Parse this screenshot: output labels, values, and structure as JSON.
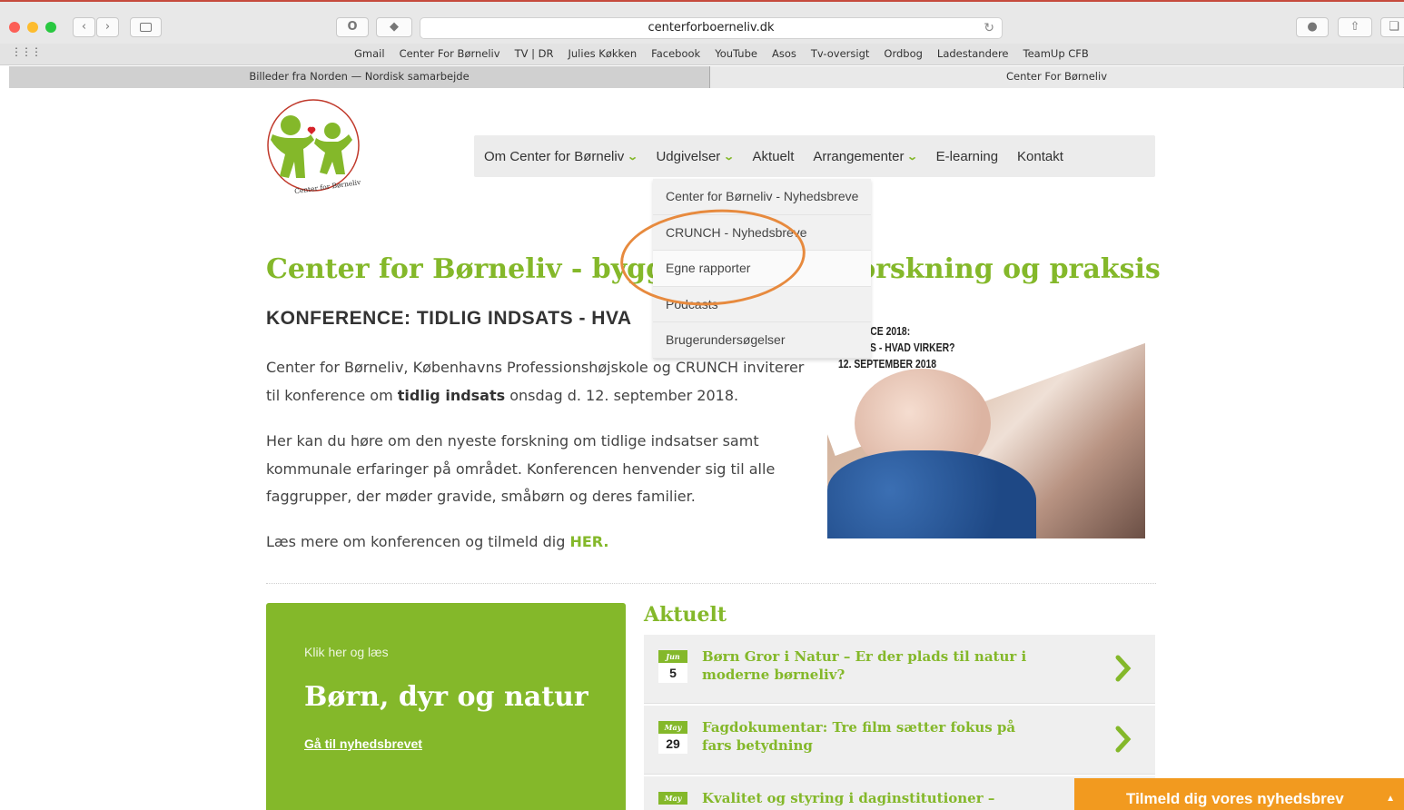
{
  "browser": {
    "url": "centerforboerneliv.dk",
    "bookmarks": [
      "Gmail",
      "Center For Børneliv",
      "TV | DR",
      "Julies Køkken",
      "Facebook",
      "YouTube",
      "Asos",
      "Tv-oversigt",
      "Ordbog",
      "Ladestandere",
      "TeamUp CFB"
    ],
    "tabs": [
      "Billeder fra Norden — Nordisk samarbejde",
      "Center For Børneliv"
    ],
    "colors": {
      "close": "#fc5f57",
      "minimize": "#fdbc2e",
      "zoom": "#28c840"
    }
  },
  "logo": {
    "text": "Center for Børneliv"
  },
  "nav": {
    "items": [
      {
        "label": "Om Center for Børneliv",
        "has_dropdown": true
      },
      {
        "label": "Udgivelser",
        "has_dropdown": true
      },
      {
        "label": "Aktuelt",
        "has_dropdown": false
      },
      {
        "label": "Arrangementer",
        "has_dropdown": true
      },
      {
        "label": "E-learning",
        "has_dropdown": false
      },
      {
        "label": "Kontakt",
        "has_dropdown": false
      }
    ]
  },
  "dropdown": {
    "items": [
      "Center for Børneliv - Nyhedsbreve",
      "CRUNCH - Nyhedsbreve",
      "Egne rapporter",
      "Podcasts",
      "Brugerundersøgelser"
    ],
    "highlighted": "Egne rapporter"
  },
  "hero": {
    "title_left": "Center for Børneliv - bygge",
    "title_right": "orskning og praksis",
    "conference_heading": "KONFERENCE: TIDLIG INDSATS - HVA",
    "para1_pre": "Center for Børneliv, Københavns Professionshøjskole og CRUNCH inviterer til konference om ",
    "para1_bold": "tidlig indsats",
    "para1_post": " onsdag d. 12. september 2018.",
    "para2": "Her kan du høre om den nyeste forskning om tidlige indsatser samt kommunale erfaringer på området. Konferencen henvender sig til alle faggrupper, der møder gravide, småbørn og deres familier.",
    "para3_pre": "Læs mere om konferencen og tilmeld dig ",
    "para3_link": "HER."
  },
  "photo": {
    "line1": "FERENCE 2018:",
    "line2": "NDSATS - HVAD VIRKER?",
    "line3": "12. SEPTEMBER 2018"
  },
  "promo": {
    "kicker": "Klik her og læs",
    "title": "Børn, dyr og natur",
    "link": "Gå til nyhedsbrevet"
  },
  "aktuelt": {
    "title": "Aktuelt",
    "items": [
      {
        "month": "Jun",
        "day": "5",
        "title": "Børn Gror i Natur – Er der plads til natur i moderne børneliv?"
      },
      {
        "month": "May",
        "day": "29",
        "title": "Fagdokumentar: Tre film sætter fokus på fars betydning"
      },
      {
        "month": "May",
        "day": "",
        "title": "Kvalitet og styring i daginstitutioner – CeDifs"
      }
    ]
  },
  "newsletter": {
    "label": "Tilmeld dig vores nyhedsbrev",
    "caret": "▲"
  },
  "theme": {
    "green": "#84b82a",
    "orange": "#f29a1f",
    "annotation": "#e78a3e"
  }
}
